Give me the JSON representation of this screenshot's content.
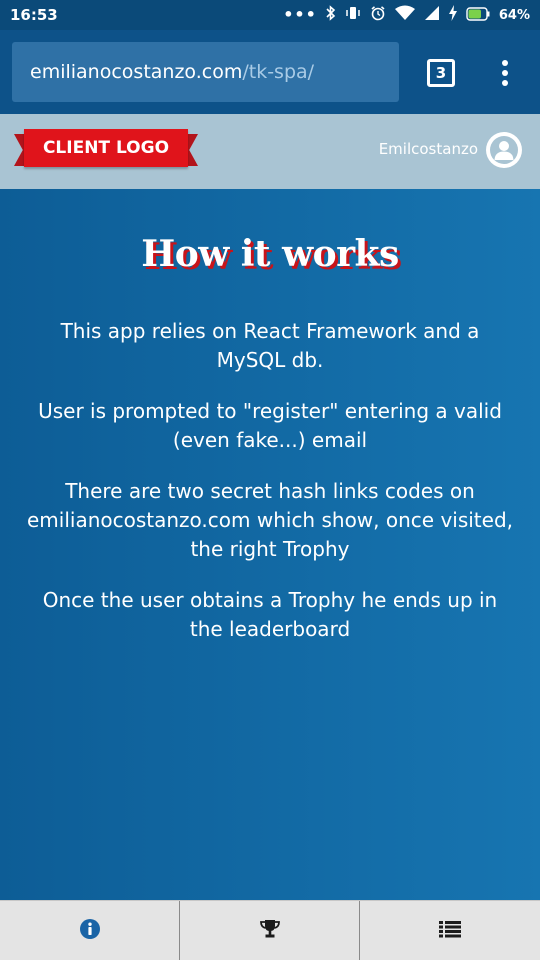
{
  "status_bar": {
    "time": "16:53",
    "battery_percent": "64%",
    "icons": [
      "more-dots-icon",
      "bluetooth-icon",
      "vibrate-icon",
      "alarm-icon",
      "wifi-icon",
      "signal-icon",
      "charging-icon",
      "battery-icon"
    ]
  },
  "browser": {
    "url_domain": "emilianocostanzo.com",
    "url_path": "/tk-spa/",
    "tab_count": "3",
    "menu_icon": "more-vert-icon"
  },
  "header": {
    "logo_text": "CLIENT LOGO",
    "username": "Emilcostanzo",
    "avatar_icon": "user-avatar-icon",
    "brand_red": "#e0141b"
  },
  "main": {
    "title": "How it works",
    "paragraphs": [
      "This app relies on React Framework and a MySQL db.",
      "User is prompted to \"register\" entering a valid (even fake...) email",
      "There are two secret hash links codes on emilianocostanzo.com which show, once visited, the right Trophy",
      "Once the user obtains a Trophy he ends up in the leaderboard"
    ]
  },
  "bottom_nav": {
    "items": [
      {
        "icon": "info-icon",
        "active": true
      },
      {
        "icon": "trophy-icon",
        "active": false
      },
      {
        "icon": "list-icon",
        "active": false
      }
    ]
  },
  "colors": {
    "status_bar": "#0b4a79",
    "toolbar": "#0d5289",
    "header_bg": "#a9c4d3",
    "content_bg": "#0f5f98",
    "active_nav": "#1a64a6"
  }
}
